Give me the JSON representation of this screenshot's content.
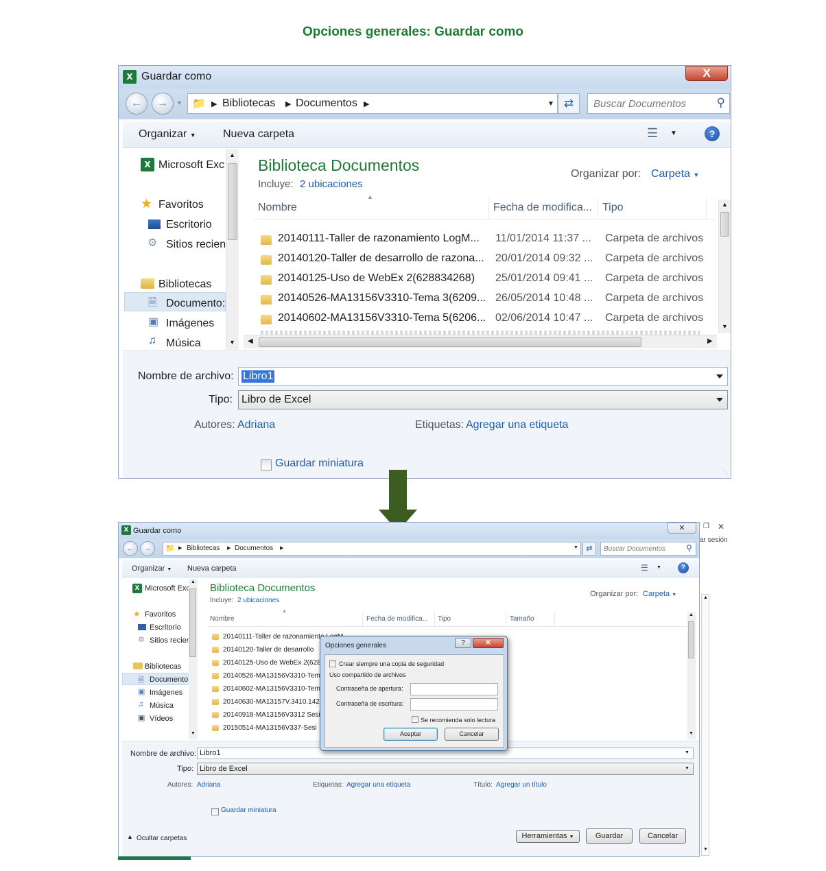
{
  "heading": "Opciones generales: Guardar como",
  "dialog1": {
    "title": "Guardar como",
    "close": "X",
    "breadcrumb": [
      "Bibliotecas",
      "Documentos"
    ],
    "search_placeholder": "Buscar Documentos",
    "toolbar": {
      "organize": "Organizar",
      "new_folder": "Nueva carpeta"
    },
    "nav": {
      "excel": "Microsoft Exc",
      "favorites": "Favoritos",
      "desktop": "Escritorio",
      "recent": "Sitios recien",
      "libraries": "Bibliotecas",
      "documents": "Documento:",
      "images": "Imágenes",
      "music": "Música"
    },
    "library_title": "Biblioteca Documentos",
    "includes_label": "Incluye:",
    "includes_link": "2 ubicaciones",
    "arrange_label": "Organizar por:",
    "arrange_value": "Carpeta",
    "columns": {
      "name": "Nombre",
      "date": "Fecha de modifica...",
      "type": "Tipo"
    },
    "files": [
      {
        "name": "20140111-Taller de razonamiento LogM...",
        "date": "11/01/2014 11:37 ...",
        "type": "Carpeta de archivos"
      },
      {
        "name": "20140120-Taller de desarrollo de razona...",
        "date": "20/01/2014 09:32 ...",
        "type": "Carpeta de archivos"
      },
      {
        "name": "20140125-Uso de WebEx 2(628834268)",
        "date": "25/01/2014 09:41 ...",
        "type": "Carpeta de archivos"
      },
      {
        "name": "20140526-MA13156V3310-Tema 3(6209...",
        "date": "26/05/2014 10:48 ...",
        "type": "Carpeta de archivos"
      },
      {
        "name": "20140602-MA13156V3310-Tema 5(6206...",
        "date": "02/06/2014 10:47 ...",
        "type": "Carpeta de archivos"
      }
    ],
    "filename_label": "Nombre de archivo:",
    "filename_value": "Libro1",
    "type_label": "Tipo:",
    "type_value": "Libro de Excel",
    "authors_label": "Autores:",
    "authors_value": "Adriana",
    "tags_label": "Etiquetas:",
    "tags_value": "Agregar una etiqueta",
    "thumbnail_label": "Guardar miniatura"
  },
  "dialog2": {
    "title": "Guardar como",
    "breadcrumb": [
      "Bibliotecas",
      "Documentos"
    ],
    "search_placeholder": "Buscar Documentos",
    "toolbar": {
      "organize": "Organizar",
      "new_folder": "Nueva carpeta"
    },
    "nav": {
      "excel": "Microsoft Exc",
      "favorites": "Favoritos",
      "desktop": "Escritorio",
      "recent": "Sitios recien",
      "libraries": "Bibliotecas",
      "documents": "Documento:",
      "images": "Imágenes",
      "music": "Música",
      "videos": "Vídeos"
    },
    "library_title": "Biblioteca Documentos",
    "includes_label": "Incluye:",
    "includes_link": "2 ubicaciones",
    "arrange_label": "Organizar por:",
    "arrange_value": "Carpeta",
    "columns": {
      "name": "Nombre",
      "date": "Fecha de modifica...",
      "type": "Tipo",
      "size": "Tamaño"
    },
    "files": [
      "20140111-Taller de razonamiento LogM...",
      "20140120-Taller de desarrollo",
      "20140125-Uso de WebEx 2(628",
      "20140526-MA13156V3310-Tem",
      "20140602-MA13156V3310-Tem",
      "20140630-MA13157V.3410.142",
      "20140918-MA13156V3312 Sesi",
      "20150514-MA13156V337-Sesi"
    ],
    "filename_label": "Nombre de archivo:",
    "filename_value": "Libro1",
    "type_label": "Tipo:",
    "type_value": "Libro de Excel",
    "authors_label": "Autores:",
    "authors_value": "Adriana",
    "tags_label": "Etiquetas:",
    "tags_value": "Agregar una etiqueta",
    "title_label": "Título:",
    "title_value": "Agregar un título",
    "thumbnail_label": "Guardar miniatura",
    "hide_folders": "Ocultar carpetas",
    "tools_button": "Herramientas",
    "save_button": "Guardar",
    "cancel_button": "Cancelar"
  },
  "options_dialog": {
    "title": "Opciones generales",
    "help": "?",
    "close": "X",
    "backup_label": "Crear siempre una copia de seguridad",
    "sharing_label": "Uso compartido de archivos",
    "open_password_label": "Contraseña de apertura:",
    "write_password_label": "Contraseña de escritura:",
    "readonly_label": "Se recomienda solo lectura",
    "ok_button": "Aceptar",
    "cancel_button": "Cancelar"
  },
  "background_fragment": "ar sesión",
  "colors": {
    "heading": "#1d7a35",
    "arrow": "#3b5d20",
    "link": "#1f5fb0",
    "excel": "#1e7a3c"
  }
}
